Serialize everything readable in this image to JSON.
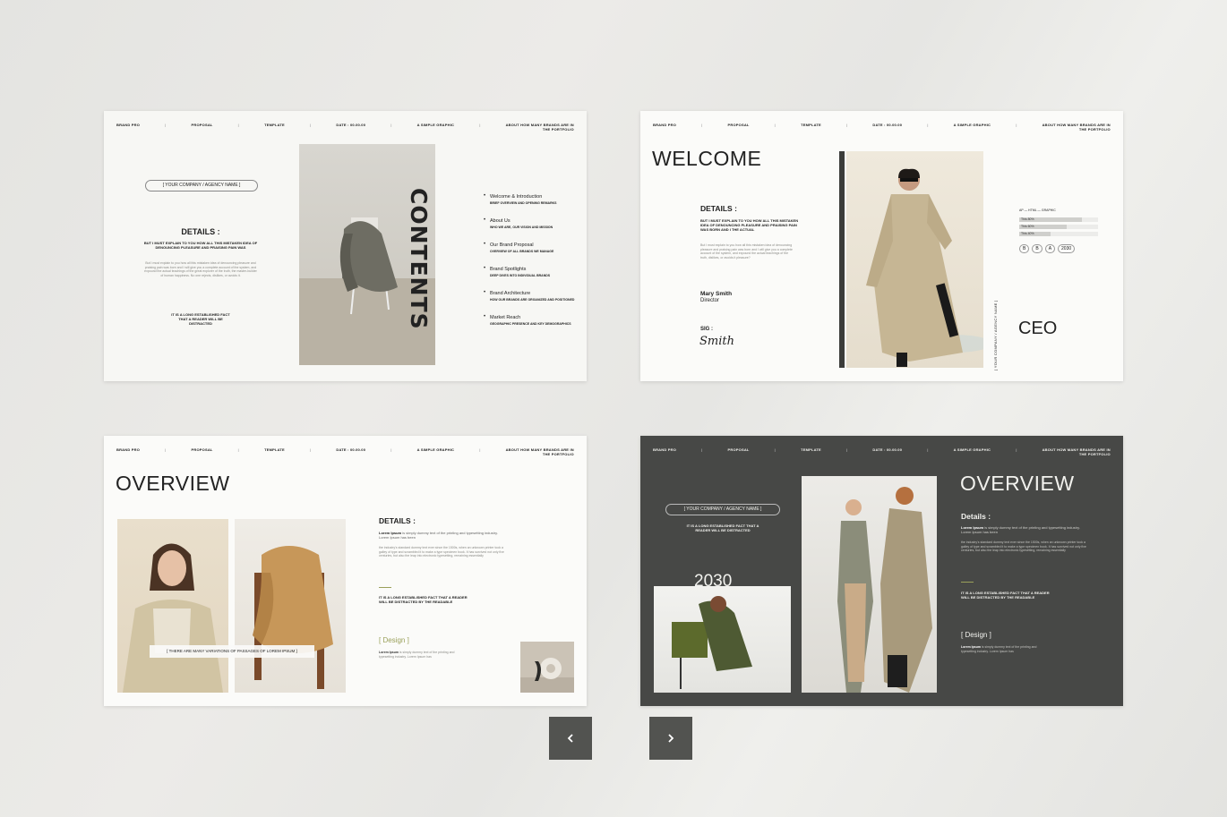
{
  "topbar": [
    "BRAND PRO",
    "PROPOSAL",
    "TEMPLATE",
    "DATE : 00.00.00",
    "A SIMPLE GRAPHIC",
    "ABOUT HOW MANY BRANDS ARE IN\nTHE PORTFOLIO"
  ],
  "slide1": {
    "company": "[ YOUR COMPANY / AGENCY NAME ]",
    "details_title": "DETAILS :",
    "details_bold": "BUT I MUST EXPLAIN TO YOU HOW ALL THIS MISTAKEN IDEA OF DENOUNCING PLEASURE AND PRAISING PAIN WAS",
    "details_body": "But I must explain to you how all this mistaken idea of denouncing pleasure and praising pain was born and I will give you a complete account of the system, and expound the actual teachings of the great explorer of the truth, the master-builder of human happiness. No one rejects, dislikes, or avoids it.",
    "fact": "IT IS A LONG ESTABLISHED FACT THAT A READER WILL BE DISTRACTED",
    "vertical_title": "CONTENTS",
    "items": [
      {
        "title": "Welcome & Introduction",
        "sub": "BRIEF OVERVIEW AND OPENING REMARKS"
      },
      {
        "title": "About Us",
        "sub": "WHO WE ARE, OUR VISION AND MISSION"
      },
      {
        "title": "Our Brand Proposal",
        "sub": "OVERVIEW OF ALL BRANDS WE MANAGE"
      },
      {
        "title": "Brand Spotlights",
        "sub": "DEEP DIVES INTO INDIVIDUAL BRANDS"
      },
      {
        "title": "Brand Architecture",
        "sub": "HOW OUR BRANDS ARE ORGANIZED AND POSITIONED"
      },
      {
        "title": "Market Reach",
        "sub": "GEOGRAPHIC PRESENCE AND KEY DEMOGRAPHICS"
      }
    ]
  },
  "slide2": {
    "title": "WELCOME",
    "details_title": "DETAILS :",
    "details_bold": "BUT I MUST EXPLAIN TO YOU HOW ALL THIS MISTAKEN IDEA OF DENOUNCING PLEASURE AND PRAISING PAIN WAS BORN AND I THE ACTUAL",
    "details_body": "But I must explain to you how all this mistaken idea of denouncing pleasure and praising pain was born and I will give you a complete account of the system, and expound the actual teachings of the truth, dislikes, or avoids it pleasure?",
    "name": "Mary Smith",
    "role": "Director",
    "sig_label": "SIG :",
    "sig": "Smith",
    "vertical_company": "[ YOUR COMPANY / AGENCY NAME ]",
    "ceo": "CEO",
    "skills_label": "AP — HTML — GRAPHIC",
    "bars": [
      {
        "label": "This 80%",
        "value": 0.8
      },
      {
        "label": "This 60%",
        "value": 0.6
      },
      {
        "label": "This 40%",
        "value": 0.4
      }
    ],
    "chips": [
      "B",
      "B",
      "A",
      "2030"
    ]
  },
  "slide3": {
    "title": "OVERVIEW",
    "caption": "[ THERE ARE MANY VARIATIONS OF PASSAGES OF LOREM IPSUM ]",
    "details_title": "DETAILS :",
    "lorem_lead": "Lorem Ipsum",
    "lorem_rest": " is simply dummy text of the printing and typesetting industry. Lorem Ipsum has been",
    "body": "the industry's standard dummy text ever since the 1500s, when an unknown printer took a galley of type and scrambled it to make a type specimen book. It has survived not only five centuries, but also the leap into electronic typesetting, remaining essentially",
    "fact": "IT IS A LONG ESTABLISHED FACT THAT A READER WILL BE DISTRACTED BY THE READABLE",
    "design": "[ Design ]",
    "design_lead": "Lorem Ipsum",
    "design_rest": " is simply dummy text of the printing and typesetting industry. Lorem Ipsum has"
  },
  "slide4": {
    "title": "OVERVIEW",
    "company": "[ YOUR COMPANY / AGENCY NAME ]",
    "fact1": "IT IS A LONG ESTABLISHED FACT THAT A READER WILL BE DISTRACTED",
    "year": "2030",
    "details_title": "Details :",
    "lorem_lead": "Lorem Ipsum",
    "lorem_rest": " is simply dummy text of the printing and typesetting industry. Lorem Ipsum has been",
    "body": "the industry's standard dummy text ever since the 1500s, when an unknown printer took a galley of type and scrambled it to make a type specimen book. It has survived not only five centuries, but also the leap into electronic typesetting, remaining essentially",
    "fact2": "IT IS A LONG ESTABLISHED FACT THAT A READER WILL BE DISTRACTED BY THE READABLE",
    "design": "[ Design ]",
    "design_lead": "Lorem Ipsum",
    "design_rest": " is simply dummy text of the printing and typesetting industry. Lorem Ipsum has"
  },
  "nav": {
    "prev_icon": "chevron-left-icon",
    "next_icon": "chevron-right-icon"
  },
  "colors": {
    "accent": "#9aa05a",
    "dark_slide": "#474846",
    "nav_button": "#525350"
  }
}
